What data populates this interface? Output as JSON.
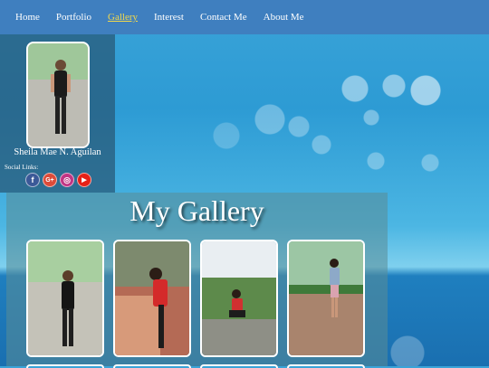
{
  "nav": {
    "items": [
      {
        "label": "Home",
        "active": false
      },
      {
        "label": "Portfolio",
        "active": false
      },
      {
        "label": "Gallery",
        "active": true
      },
      {
        "label": "Interest",
        "active": false
      },
      {
        "label": "Contact Me",
        "active": false
      },
      {
        "label": "About Me",
        "active": false
      }
    ]
  },
  "profile": {
    "name": "Sheila Mae N. Aguilan",
    "social_title": "Social Links:",
    "social": [
      {
        "icon": "facebook-icon",
        "glyph": "f",
        "color": "#3b5998"
      },
      {
        "icon": "google-plus-icon",
        "glyph": "G+",
        "color": "#dd4b39"
      },
      {
        "icon": "instagram-icon",
        "glyph": "◎",
        "color": "#c13584"
      },
      {
        "icon": "youtube-icon",
        "glyph": "▶",
        "color": "#e62117"
      }
    ]
  },
  "gallery": {
    "title": "My Gallery",
    "photos": [
      {
        "name": "gallery-photo-1"
      },
      {
        "name": "gallery-photo-2"
      },
      {
        "name": "gallery-photo-3"
      },
      {
        "name": "gallery-photo-4"
      }
    ]
  },
  "colors": {
    "navbar": "#3f7fbf",
    "active_nav": "#f2d84b"
  }
}
